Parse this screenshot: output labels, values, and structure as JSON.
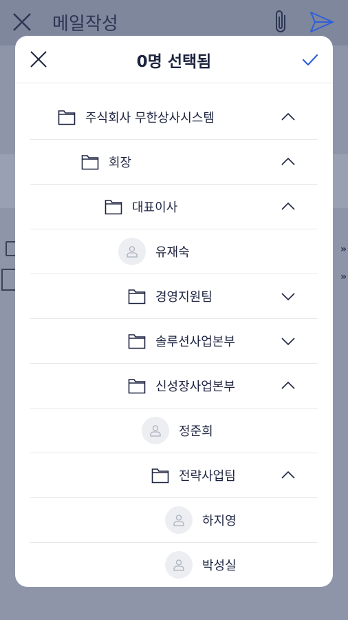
{
  "background": {
    "title": "메일작성",
    "icons": [
      "close-icon",
      "attachment-icon",
      "send-icon"
    ],
    "row_arrows": "»"
  },
  "modal": {
    "title": "0명 선택됨",
    "icons": {
      "close": "close-icon",
      "confirm": "checkmark-icon"
    }
  },
  "tree": [
    {
      "type": "folder",
      "label": "주식회사 무한상사시스템",
      "level": 0,
      "expanded": true
    },
    {
      "type": "folder",
      "label": "회장",
      "level": 1,
      "expanded": true
    },
    {
      "type": "folder",
      "label": "대표이사",
      "level": 2,
      "expanded": true
    },
    {
      "type": "person",
      "label": "유재숙",
      "level": 2
    },
    {
      "type": "folder",
      "label": "경영지원팀",
      "level": 3,
      "expanded": false
    },
    {
      "type": "folder",
      "label": "솔루션사업본부",
      "level": 3,
      "expanded": false
    },
    {
      "type": "folder",
      "label": "신성장사업본부",
      "level": 3,
      "expanded": true
    },
    {
      "type": "person",
      "label": "정준희",
      "level": 3
    },
    {
      "type": "folder",
      "label": "전략사업팀",
      "level": 4,
      "expanded": true
    },
    {
      "type": "person",
      "label": "하지영",
      "level": 4
    },
    {
      "type": "person",
      "label": "박성실",
      "level": 4
    }
  ],
  "colors": {
    "accent": "#2f5fd8",
    "text": "#1d2440",
    "divider": "#e6e8ec"
  }
}
